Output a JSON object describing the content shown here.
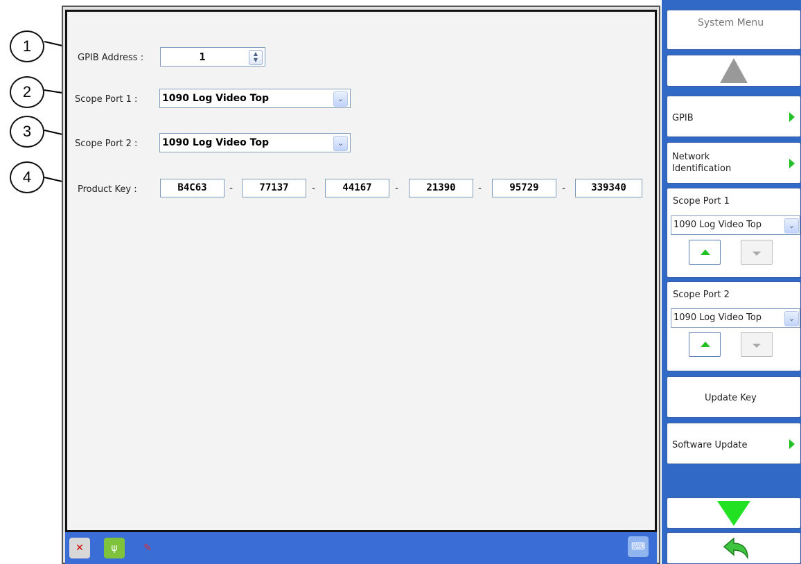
{
  "callouts": [
    "1",
    "2",
    "3",
    "4"
  ],
  "form": {
    "gpib_label": "GPIB Address :",
    "gpib_value": "1",
    "scope1_label": "Scope Port 1 :",
    "scope1_value": "1090 Log Video Top",
    "scope2_label": "Scope Port 2 :",
    "scope2_value": "1090 Log Video Top",
    "product_key_label": "Product Key :",
    "product_key": [
      "B4C63",
      "77137",
      "44167",
      "21390",
      "95729",
      "339340"
    ],
    "separator": "-"
  },
  "side_panel": {
    "title": "System Menu",
    "gpib": "GPIB",
    "network_line1": "Network",
    "network_line2": "Identification",
    "scope1_title": "Scope Port 1",
    "scope1_value": "1090 Log Video Top",
    "scope2_title": "Scope Port 2",
    "scope2_value": "1090 Log Video Top",
    "update_key": "Update Key",
    "software_update": "Software Update"
  },
  "icons": [
    "network-disconnected-icon",
    "usb-icon",
    "tools-icon",
    "keyboard-icon",
    "up-arrow-icon",
    "down-arrow-icon",
    "back-arrow-icon"
  ],
  "colors": {
    "taskbar": "#3a6dd6",
    "panel": "#3169c6",
    "green": "#22c022"
  }
}
